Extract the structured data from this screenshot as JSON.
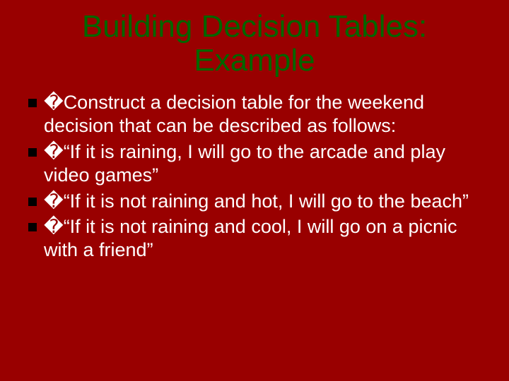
{
  "slide": {
    "title_line_1": "Building Decision Tables:",
    "title_line_2": "Example",
    "bullets": [
      {
        "marker": "�",
        "text": "Construct a decision table for the weekend decision that can be described as follows:"
      },
      {
        "marker": "�",
        "text": "“If it is raining, I will go to the arcade and play video games”"
      },
      {
        "marker": "�",
        "text": "“If it is not raining and hot, I will go to the beach”"
      },
      {
        "marker": "�",
        "text": "“If it is not raining and cool, I will go on a picnic with a friend”"
      }
    ]
  }
}
